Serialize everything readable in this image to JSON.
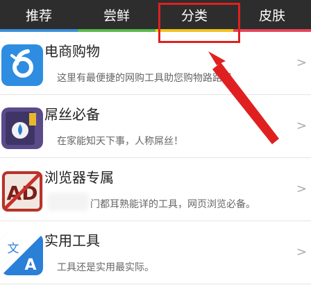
{
  "tabs": [
    {
      "label": "推荐",
      "underline": "#3a8fd8"
    },
    {
      "label": "尝鲜",
      "underline": "#58b84a"
    },
    {
      "label": "分类",
      "underline": "#f2c21a",
      "active": true
    },
    {
      "label": "皮肤",
      "underline": "#e6455a"
    }
  ],
  "items": [
    {
      "title": "电商购物",
      "desc": "这里有最便捷的网购工具助您购物路路通",
      "chevron": ">"
    },
    {
      "title": "屌丝必备",
      "desc": "在家能知天下事，人称屌丝！",
      "chevron": ">"
    },
    {
      "title": "浏览器专属",
      "desc": "门都耳熟能详的工具，网页浏览必备。",
      "chevron": ">"
    },
    {
      "title": "实用工具",
      "desc": "工具还是实用最实际。",
      "chevron": ">"
    }
  ],
  "icons": {
    "item0": {
      "text": "6",
      "bg": "#2e8de0"
    },
    "item1": {
      "bg": "#5a4a8a"
    },
    "item2": {
      "text": "AD",
      "bg": "#f0e8e0"
    },
    "item3": {
      "text_a": "文",
      "text_b": "A",
      "bg": "#2a7fd6"
    }
  },
  "colors": {
    "annotation": "#e02020",
    "tabbar": "#2d2d2d"
  }
}
